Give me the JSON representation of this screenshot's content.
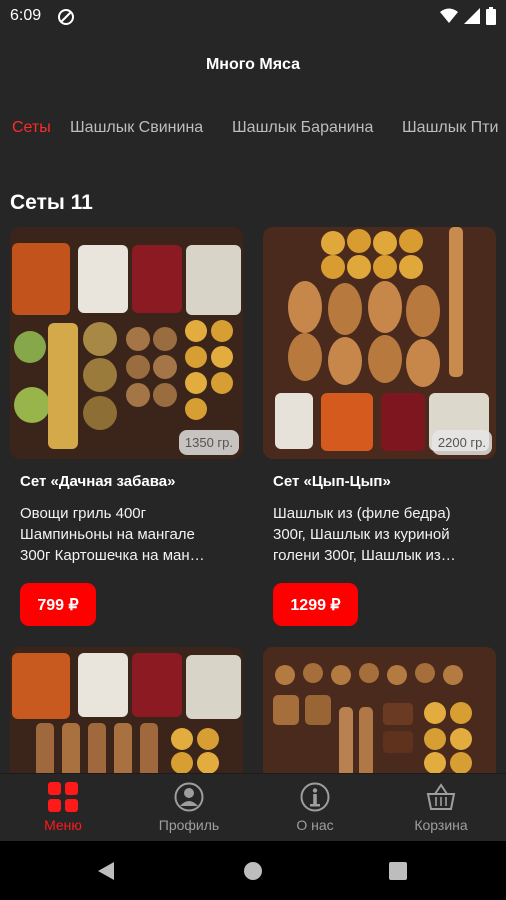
{
  "status": {
    "time": "6:09"
  },
  "header": {
    "title": "Много Мяса"
  },
  "tabs": [
    {
      "label": "Сеты"
    },
    {
      "label": "Шашлык Свинина"
    },
    {
      "label": "Шашлык Баранина"
    },
    {
      "label": "Шашлык Пти"
    }
  ],
  "section": {
    "title": "Сеты 11"
  },
  "products": [
    {
      "weight": "1350 гр.",
      "name": "Сет «Дачная забава»",
      "desc": [
        "Овощи гриль 400г",
        "Шампиньоны на мангале",
        "300г Картошечка на ман…"
      ],
      "price": "799 ₽"
    },
    {
      "weight": "2200 гр.",
      "name": "Сет «Цып-Цып»",
      "desc": [
        "Шашлык из (филе бедра)",
        "300г, Шашлык из куриной",
        "голени 300г, Шашлык из…"
      ],
      "price": "1299 ₽"
    }
  ],
  "bottom_nav": [
    {
      "label": "Меню",
      "icon": "menu-grid-icon"
    },
    {
      "label": "Профиль",
      "icon": "profile-icon"
    },
    {
      "label": "О нас",
      "icon": "info-icon"
    },
    {
      "label": "Корзина",
      "icon": "basket-icon"
    }
  ],
  "colors": {
    "background": "#262626",
    "accent": "#ff0000",
    "inactive": "#9e9e9e"
  }
}
